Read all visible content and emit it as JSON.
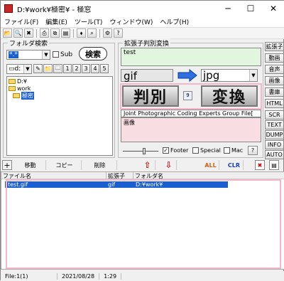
{
  "window": {
    "title": "D:¥work¥極密¥ - 極窓"
  },
  "menu": [
    "ファイル(F)",
    "編集(E)",
    "ツール(T)",
    "ウィンドウ(W)",
    "ヘルプ(H)"
  ],
  "folder_search": {
    "label": "フォルダ検索",
    "pattern_value": "*.*",
    "sub_label": "Sub",
    "search_button": "検索",
    "drive_value": "d:",
    "nav_buttons": [
      "1",
      "2",
      "3",
      "4",
      "5"
    ],
    "tree": [
      "D:¥",
      "work",
      "極密"
    ]
  },
  "converter": {
    "label": "拡張子判別変換",
    "text_value": "test",
    "from_ext": "gif",
    "to_ext": "jpg",
    "identify_button": "判別",
    "count": "9",
    "convert_button": "変換",
    "description": "Joint Photographic Coding Experts Group File[",
    "category": "画像",
    "footer_label": "Footer",
    "special_label": "Special",
    "mac_label": "Mac",
    "help_label": "?"
  },
  "side_buttons": [
    "拡張子",
    "動画",
    "音声",
    "画像",
    "書庫",
    "HTML",
    "SCR",
    "TEXT",
    "DUMP",
    "INFO",
    "AUTO"
  ],
  "actions": {
    "add": "+",
    "move": "移動",
    "copy": "コピー",
    "delete": "削除",
    "up": "⇧",
    "down": "⇩",
    "all": "ALL",
    "clr": "CLR"
  },
  "file_list": {
    "headers": [
      "ファイル名",
      "拡張子",
      "フォルダ名"
    ],
    "rows": [
      {
        "name": "test.gif",
        "ext": "gif",
        "folder": "D:¥work¥"
      }
    ]
  },
  "status": {
    "files": "File:1(1)",
    "date": "2021/08/28",
    "time": "1:29"
  },
  "colors": {
    "selection": "#1a5fd0",
    "pink_highlight": "#f4b6c8",
    "green_field": "#e2f5df",
    "pink_field": "#f8dde3"
  }
}
